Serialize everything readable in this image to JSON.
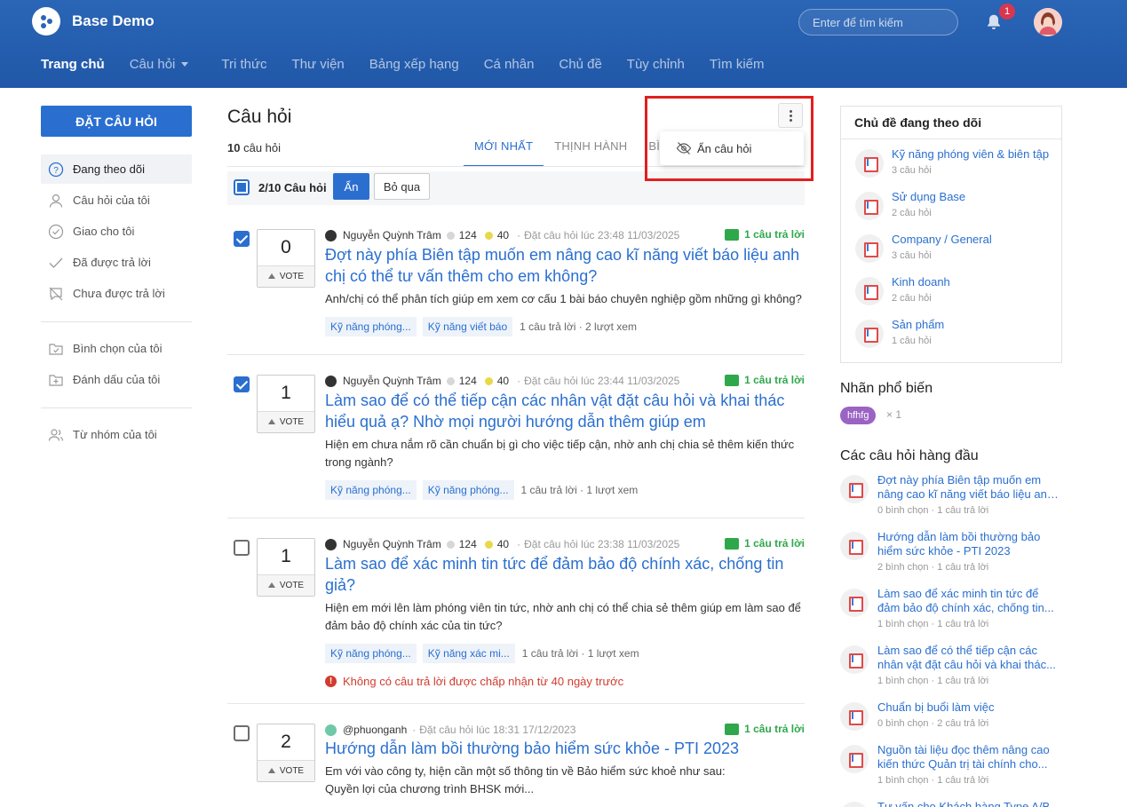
{
  "header": {
    "brand": "Base Demo",
    "search_placeholder": "Enter để tìm kiếm",
    "notification_count": "1",
    "nav": [
      {
        "label": "Trang chủ",
        "active": true
      },
      {
        "label": "Câu hỏi",
        "dropdown": true
      },
      {
        "label": "Tri thức"
      },
      {
        "label": "Thư viện"
      },
      {
        "label": "Bảng xếp hạng"
      },
      {
        "label": "Cá nhân"
      },
      {
        "label": "Chủ đề"
      },
      {
        "label": "Tùy chỉnh"
      },
      {
        "label": "Tìm kiếm"
      }
    ]
  },
  "sidebar": {
    "ask_button": "ĐẶT CÂU HỎI",
    "items": [
      {
        "label": "Đang theo dõi",
        "icon": "question-circle-icon",
        "active": true
      },
      {
        "label": "Câu hỏi của tôi",
        "icon": "user-icon"
      },
      {
        "label": "Giao cho tôi",
        "icon": "check-circle-icon"
      },
      {
        "label": "Đã được trả lời",
        "icon": "checkmark-icon"
      },
      {
        "label": "Chưa được trả lời",
        "icon": "chat-slash-icon"
      },
      {
        "label": "Bình chọn của tôi",
        "icon": "vote-box-icon",
        "group_start": true
      },
      {
        "label": "Đánh dấu của tôi",
        "icon": "bookmark-folder-icon"
      },
      {
        "label": "Từ nhóm của tôi",
        "icon": "group-icon",
        "group_start": true
      }
    ]
  },
  "main": {
    "title": "Câu hỏi",
    "count_num": "10",
    "count_label": "câu hỏi",
    "tabs": [
      {
        "label": "MỚI NHẤT",
        "active": true
      },
      {
        "label": "THỊNH HÀNH"
      },
      {
        "label": "BÌNH"
      }
    ],
    "menu_item": "Ẩn câu hỏi",
    "bulk": {
      "selected_label": "2/10 Câu hỏi",
      "hide_button": "Ẩn",
      "skip_button": "Bỏ qua"
    },
    "vote_label": "VOTE",
    "questions": [
      {
        "checked": true,
        "votes": "0",
        "author": "Nguyễn Quỳnh Trâm",
        "rep_gray": "124",
        "rep_yellow": "40",
        "asked": "Đặt câu hỏi lúc 23:48 11/03/2025",
        "answers": "1 câu trả lời",
        "title_lines": [
          "Đợt này phía Biên tập muốn em nâng cao kĩ năng viết báo liệu anh",
          "chị có thể tư vấn thêm cho em không?"
        ],
        "desc_lines": [
          "Anh/chị có thể phân tích giúp em xem cơ cấu 1 bài báo chuyên nghiệp gồm những gì không?"
        ],
        "tags": [
          "Kỹ năng phóng...",
          "Kỹ năng viết báo"
        ],
        "stats": "1 câu trả lời · 2 lượt xem"
      },
      {
        "checked": true,
        "votes": "1",
        "author": "Nguyễn Quỳnh Trâm",
        "rep_gray": "124",
        "rep_yellow": "40",
        "asked": "Đặt câu hỏi lúc 23:44 11/03/2025",
        "answers": "1 câu trả lời",
        "title_lines": [
          "Làm sao để có thể tiếp cận các nhân vật đặt câu hỏi và khai thác",
          "hiểu quả ạ? Nhờ mọi người hướng dẫn thêm giúp em"
        ],
        "desc_lines": [
          "Hiện em chưa nắm rõ cần chuẩn bị gì cho việc tiếp cận, nhờ anh chị chia sẻ thêm kiến thức",
          "trong ngành?"
        ],
        "tags": [
          "Kỹ năng phóng...",
          "Kỹ năng phóng..."
        ],
        "stats": "1 câu trả lời · 1 lượt xem"
      },
      {
        "checked": false,
        "votes": "1",
        "author": "Nguyễn Quỳnh Trâm",
        "rep_gray": "124",
        "rep_yellow": "40",
        "asked": "Đặt câu hỏi lúc 23:38 11/03/2025",
        "answers": "1 câu trả lời",
        "title_lines": [
          "Làm sao để xác minh tin tức để đảm bảo độ chính xác, chống tin",
          "giả?"
        ],
        "desc_lines": [
          "Hiện em mới lên làm phóng viên tin tức, nhờ anh chị có thể chia sẻ thêm giúp em làm sao để",
          "đảm bảo độ chính xác của tin tức?"
        ],
        "tags": [
          "Kỹ năng phóng...",
          "Kỹ năng xác mi..."
        ],
        "stats": "1 câu trả lời · 1 lượt xem",
        "warning": "Không có câu trả lời được chấp nhận từ 40 ngày trước"
      },
      {
        "checked": false,
        "votes": "2",
        "author": "@phuonganh",
        "asked": "Đặt câu hỏi lúc 18:31 17/12/2023",
        "answers": "1 câu trả lời",
        "title_lines": [
          "Hướng dẫn làm bồi thường bảo hiểm sức khỏe - PTI 2023"
        ],
        "desc_lines": [
          "Em với vào công ty, hiện cần một số thông tin về Bảo hiểm sức khoẻ như sau:",
          "Quyền lợi của chương trình BHSK mới..."
        ]
      }
    ]
  },
  "right": {
    "follow_title": "Chủ đề đang theo dõi",
    "topics": [
      {
        "name": "Kỹ năng phóng viên & biên tập",
        "count": "3 câu hỏi"
      },
      {
        "name": "Sử dụng Base",
        "count": "2 câu hỏi"
      },
      {
        "name": "Company / General",
        "count": "3 câu hỏi"
      },
      {
        "name": "Kinh doanh",
        "count": "2 câu hỏi"
      },
      {
        "name": "Sản phẩm",
        "count": "1 câu hỏi"
      }
    ],
    "popular_title": "Nhãn phổ biến",
    "popular_tag": "hfhfg",
    "popular_tag_count": "× 1",
    "top_title": "Các câu hỏi hàng đầu",
    "top_questions": [
      {
        "lines": [
          "Đợt này phía Biên tập muốn em",
          "nâng cao kĩ năng viết báo liệu anh..."
        ],
        "stats": "0 bình chọn · 1 câu trả lời"
      },
      {
        "lines": [
          "Hướng dẫn làm bồi thường bảo",
          "hiểm sức khỏe - PTI 2023"
        ],
        "stats": "2 bình chọn · 1 câu trả lời"
      },
      {
        "lines": [
          "Làm sao để xác minh tin tức để",
          "đảm bảo độ chính xác, chống tin..."
        ],
        "stats": "1 bình chọn · 1 câu trả lời"
      },
      {
        "lines": [
          "Làm sao để có thể tiếp cận các",
          "nhân vật đặt câu hỏi và khai thác..."
        ],
        "stats": "1 bình chọn · 1 câu trả lời"
      },
      {
        "lines": [
          "Chuẩn bị buổi làm việc"
        ],
        "stats": "0 bình chọn · 2 câu trả lời"
      },
      {
        "lines": [
          "Nguồn tài liệu đọc thêm nâng cao",
          "kiến thức Quản trị tài chính cho..."
        ],
        "stats": "1 bình chọn · 1 câu trả lời"
      },
      {
        "lines": [
          "Tư vấn cho Khách hàng Type A/B"
        ],
        "stats": ""
      }
    ]
  },
  "colors": {
    "header_bg": "#2158a8",
    "accent": "#2a6fd0",
    "answered_green": "#2ea84b",
    "warning_red": "#d23b2e",
    "tag_purple": "#9b63c4",
    "highlight_red": "#e0201f"
  }
}
